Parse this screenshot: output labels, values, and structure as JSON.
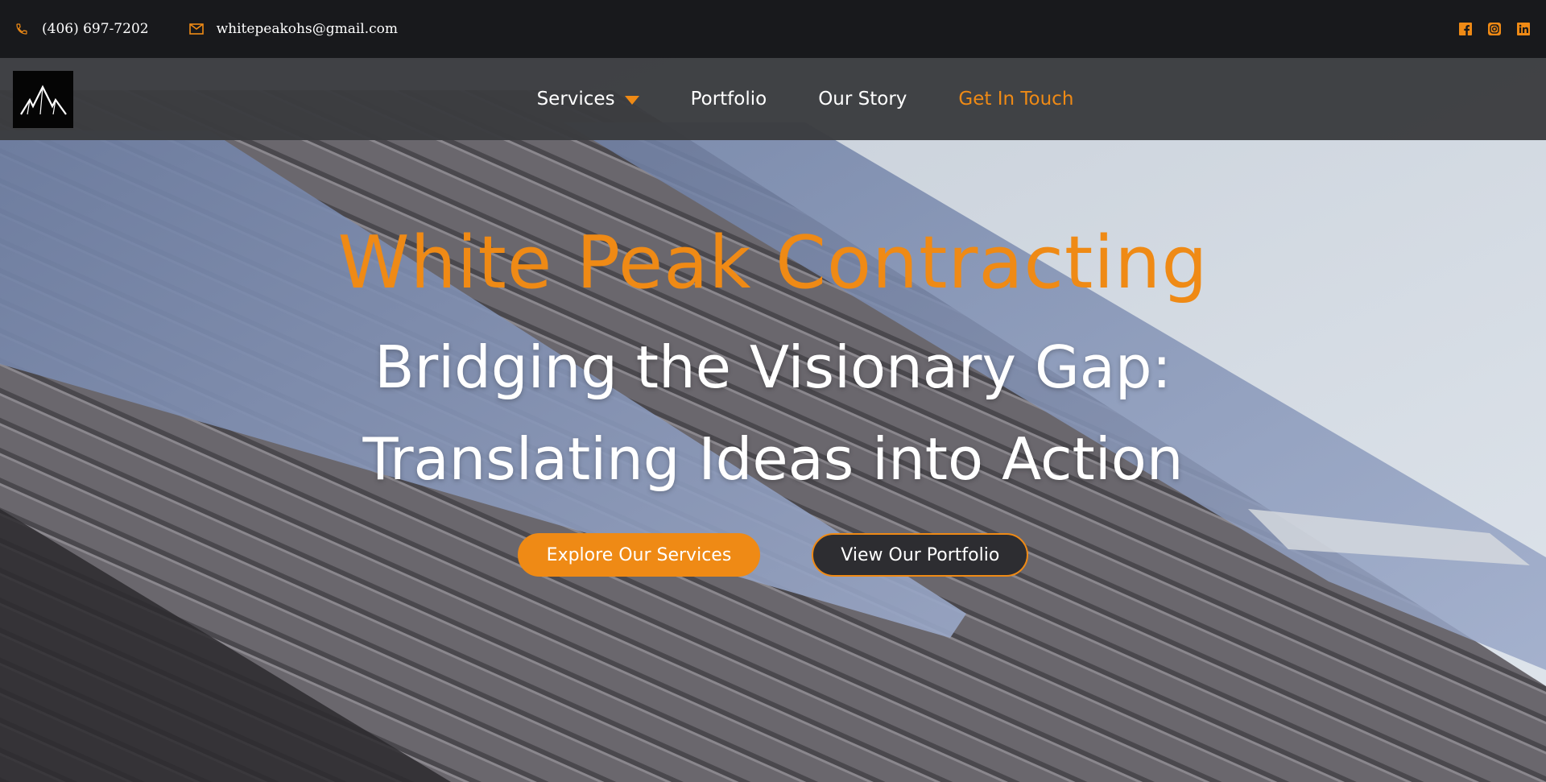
{
  "topbar": {
    "phone": "(406) 697-7202",
    "email": "whitepeakohs@gmail.com",
    "phone_icon": "phone-icon",
    "email_icon": "mail-icon",
    "socials": [
      "facebook-icon",
      "instagram-icon",
      "linkedin-icon"
    ]
  },
  "nav": {
    "logo_icon": "mountain-logo",
    "items": [
      {
        "label": "Services"
      },
      {
        "label": "Portfolio"
      },
      {
        "label": "Our Story"
      },
      {
        "label": "Get In Touch"
      }
    ]
  },
  "hero": {
    "brand": "White Peak Contracting",
    "tagline_line1": "Bridging the Visionary Gap:",
    "tagline_line2": "Translating Ideas into Action",
    "primary_button": "Explore Our Services",
    "secondary_button": "View Our Portfolio"
  },
  "colors": {
    "accent": "#ef8a15",
    "topbar_bg": "#18191c",
    "nav_bg": "#3a3b3e"
  }
}
